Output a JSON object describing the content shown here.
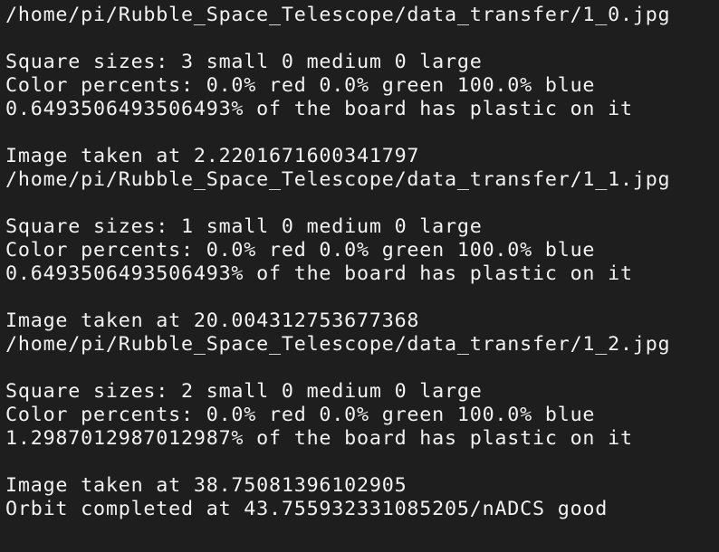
{
  "terminal": {
    "lines": [
      "/home/pi/Rubble_Space_Telescope/data_transfer/1_0.jpg",
      "",
      "Square sizes: 3 small 0 medium 0 large",
      "Color percents: 0.0% red 0.0% green 100.0% blue",
      "0.6493506493506493% of the board has plastic on it",
      "",
      "Image taken at 2.2201671600341797",
      "/home/pi/Rubble_Space_Telescope/data_transfer/1_1.jpg",
      "",
      "Square sizes: 1 small 0 medium 0 large",
      "Color percents: 0.0% red 0.0% green 100.0% blue",
      "0.6493506493506493% of the board has plastic on it",
      "",
      "Image taken at 20.004312753677368",
      "/home/pi/Rubble_Space_Telescope/data_transfer/1_2.jpg",
      "",
      "Square sizes: 2 small 0 medium 0 large",
      "Color percents: 0.0% red 0.0% green 100.0% blue",
      "1.2987012987012987% of the board has plastic on it",
      "",
      "Image taken at 38.75081396102905",
      "Orbit completed at 43.755932331085205/nADCS good"
    ]
  },
  "colors": {
    "background": "#1e1e1e",
    "text": "#f2f2f2"
  }
}
